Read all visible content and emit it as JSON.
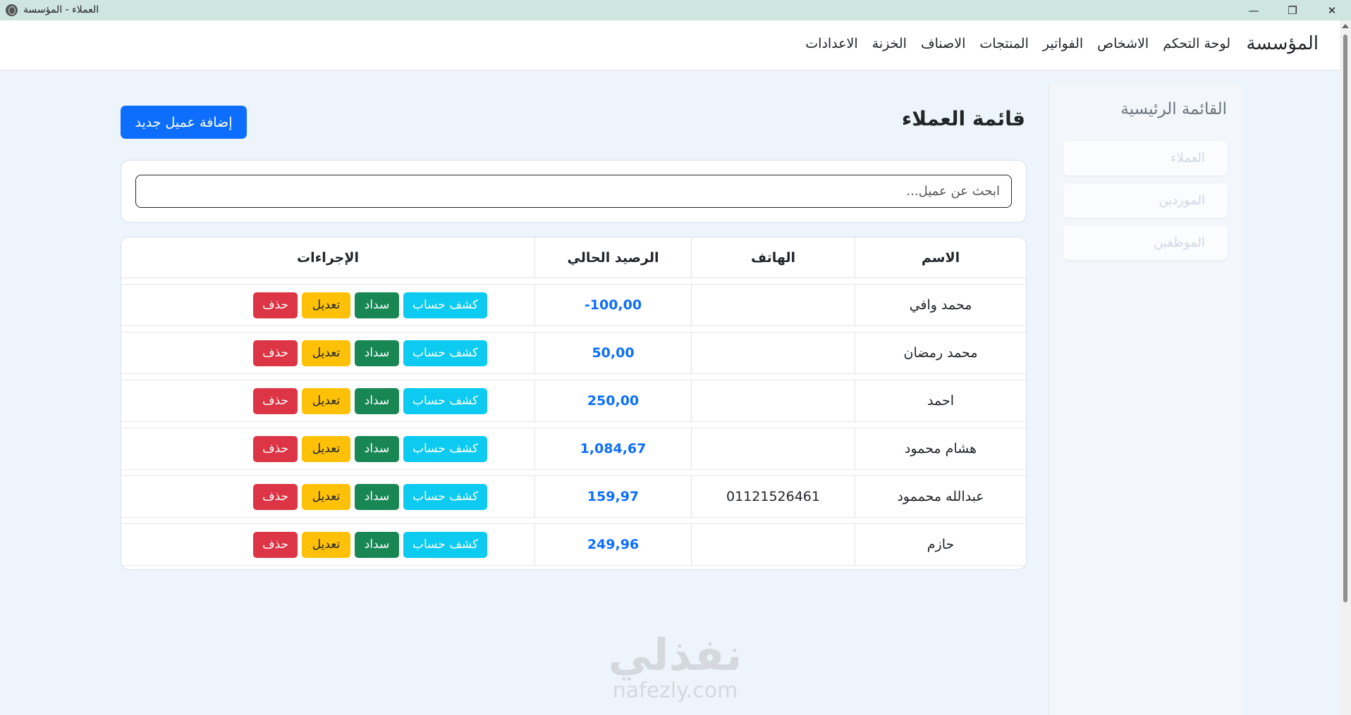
{
  "window": {
    "title": "العملاء - المؤسسة",
    "minimize": "—",
    "restore": "❐",
    "close": "✕"
  },
  "navbar": {
    "brand": "المؤسسة",
    "links": [
      "لوحة التحكم",
      "الاشخاص",
      "الفواتير",
      "المنتجات",
      "الاصناف",
      "الخزنة",
      "الاعدادات"
    ]
  },
  "sidebar": {
    "title": "القائمة الرئيسية",
    "items": [
      "العملاء",
      "الموردين",
      "الموظفين"
    ]
  },
  "main": {
    "title": "قائمة العملاء",
    "add_button": "إضافة عميل جديد",
    "search_placeholder": "ابحث عن عميل...",
    "table": {
      "headers": [
        "الاسم",
        "الهاتف",
        "الرصيد الحالي",
        "الإجراءات"
      ],
      "rows": [
        {
          "name": "محمد وافي",
          "phone": "",
          "balance": "-100,00"
        },
        {
          "name": "محمد رمضان",
          "phone": "",
          "balance": "50,00"
        },
        {
          "name": "احمد",
          "phone": "",
          "balance": "250,00"
        },
        {
          "name": "هشام محمود",
          "phone": "",
          "balance": "1,084,67"
        },
        {
          "name": "عبدالله محممود",
          "phone": "01121526461",
          "balance": "159,97"
        },
        {
          "name": "حازم",
          "phone": "",
          "balance": "249,96"
        }
      ],
      "actions": {
        "statement": "كشف حساب",
        "pay": "سداد",
        "edit": "تعديل",
        "delete": "حذف"
      }
    }
  },
  "watermark": {
    "arabic": "نفذلي",
    "latin": "nafezly.com"
  },
  "colors": {
    "primary": "#0d6efd",
    "info": "#0dcaf0",
    "success": "#198754",
    "warning": "#ffc107",
    "danger": "#dc3545"
  }
}
